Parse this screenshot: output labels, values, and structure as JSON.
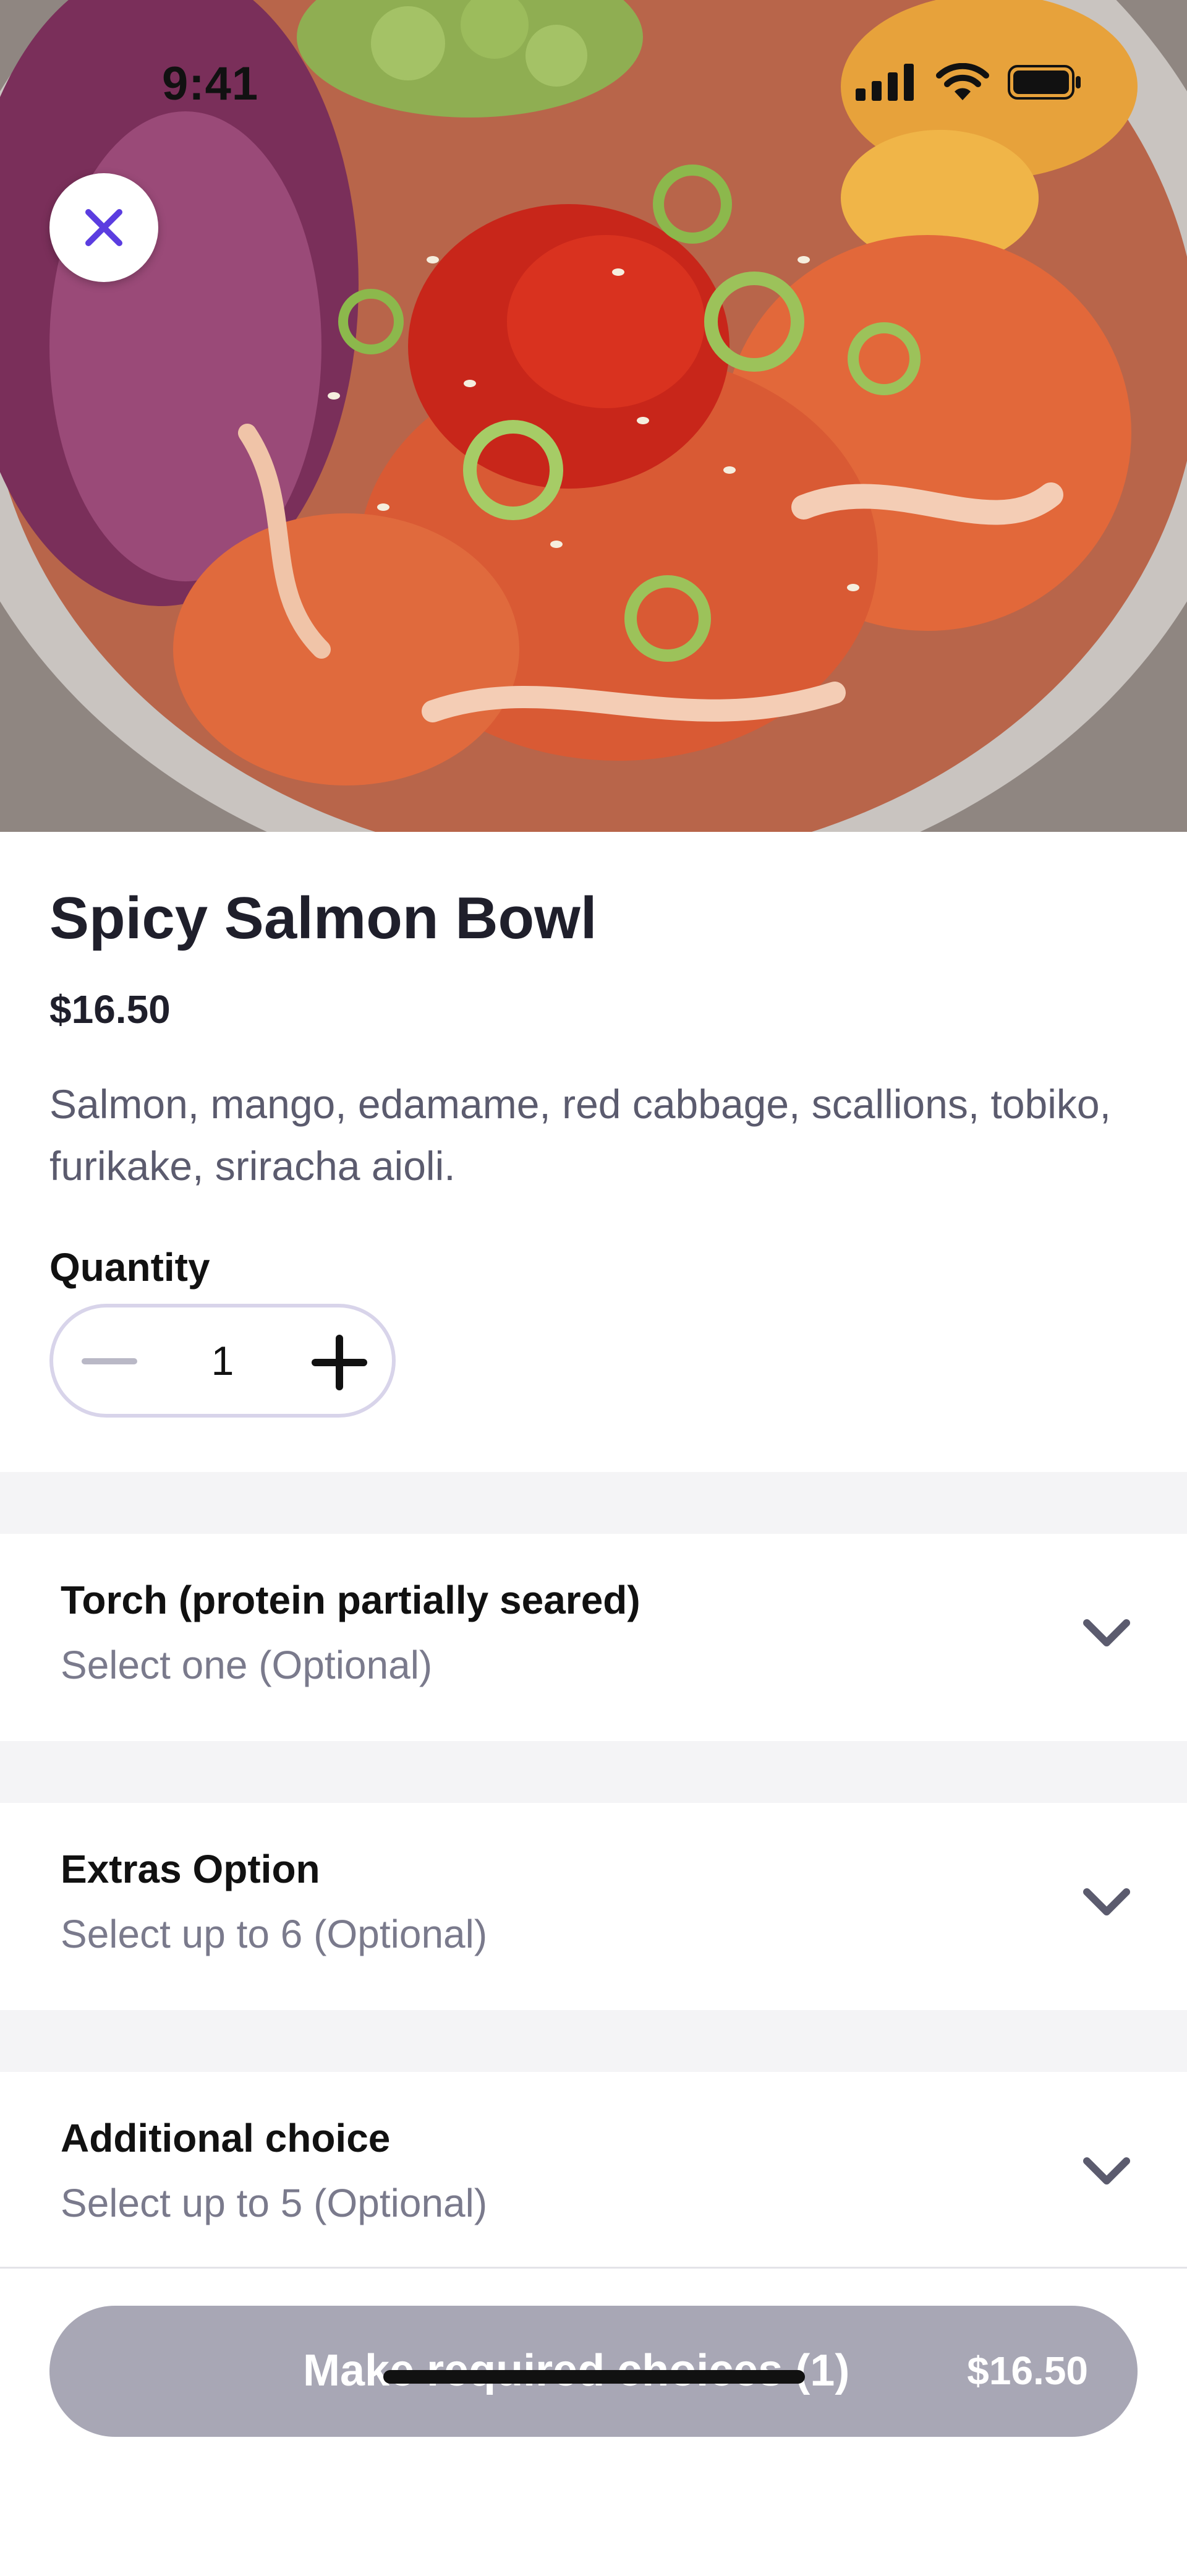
{
  "status_bar": {
    "time": "9:41",
    "icons": [
      "signal-icon",
      "wifi-icon",
      "battery-icon"
    ]
  },
  "hero": {
    "image": "poke-bowl-photo",
    "close_icon": "close-icon"
  },
  "item": {
    "title": "Spicy Salmon Bowl",
    "price": "$16.50",
    "description": "Salmon, mango, edamame, red cabbage, scallions, tobiko, furikake, sriracha aioli."
  },
  "quantity": {
    "label": "Quantity",
    "value": "1"
  },
  "options": [
    {
      "title": "Torch (protein partially seared)",
      "subtitle": "Select one (Optional)",
      "icon": "chevron-down-icon"
    },
    {
      "title": "Extras Option",
      "subtitle": "Select up to 6 (Optional)",
      "icon": "chevron-down-icon"
    },
    {
      "title": "Additional choice",
      "subtitle": "Select up to 5 (Optional)",
      "icon": "chevron-down-icon"
    }
  ],
  "cta": {
    "label": "Make required choices (1)",
    "price": "$16.50"
  },
  "colors": {
    "accent": "#5b3de0",
    "cta_disabled": "#a8a7b5",
    "section_gap": "#f4f4f6"
  }
}
